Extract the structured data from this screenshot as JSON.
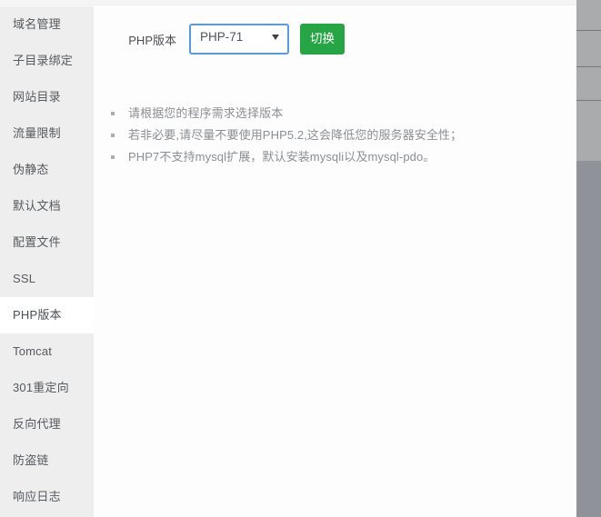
{
  "sidebar": {
    "items": [
      {
        "label": "域名管理",
        "active": false
      },
      {
        "label": "子目录绑定",
        "active": false
      },
      {
        "label": "网站目录",
        "active": false
      },
      {
        "label": "流量限制",
        "active": false
      },
      {
        "label": "伪静态",
        "active": false
      },
      {
        "label": "默认文档",
        "active": false
      },
      {
        "label": "配置文件",
        "active": false
      },
      {
        "label": "SSL",
        "active": false
      },
      {
        "label": "PHP版本",
        "active": true
      },
      {
        "label": "Tomcat",
        "active": false
      },
      {
        "label": "301重定向",
        "active": false
      },
      {
        "label": "反向代理",
        "active": false
      },
      {
        "label": "防盗链",
        "active": false
      },
      {
        "label": "响应日志",
        "active": false
      }
    ]
  },
  "main": {
    "form": {
      "label": "PHP版本",
      "select": {
        "value": "PHP-71",
        "options": [
          "PHP-71"
        ]
      },
      "submit_label": "切换"
    },
    "notes": [
      "请根据您的程序需求选择版本",
      "若非必要,请尽量不要使用PHP5.2,这会降低您的服务器安全性；",
      "PHP7不支持mysql扩展，默认安装mysqli以及mysql-pdo。"
    ]
  },
  "colors": {
    "accent_green": "#26a544",
    "focus_blue": "#559bec",
    "sidebar_bg": "#eeeeee",
    "active_item_bg": "#ffffff",
    "note_text": "#8a8f93",
    "right_panel_upper": "#aaabad",
    "right_panel_lower": "#8f9298"
  },
  "right_panel": {
    "divider_positions": [
      33,
      73,
      110
    ]
  }
}
